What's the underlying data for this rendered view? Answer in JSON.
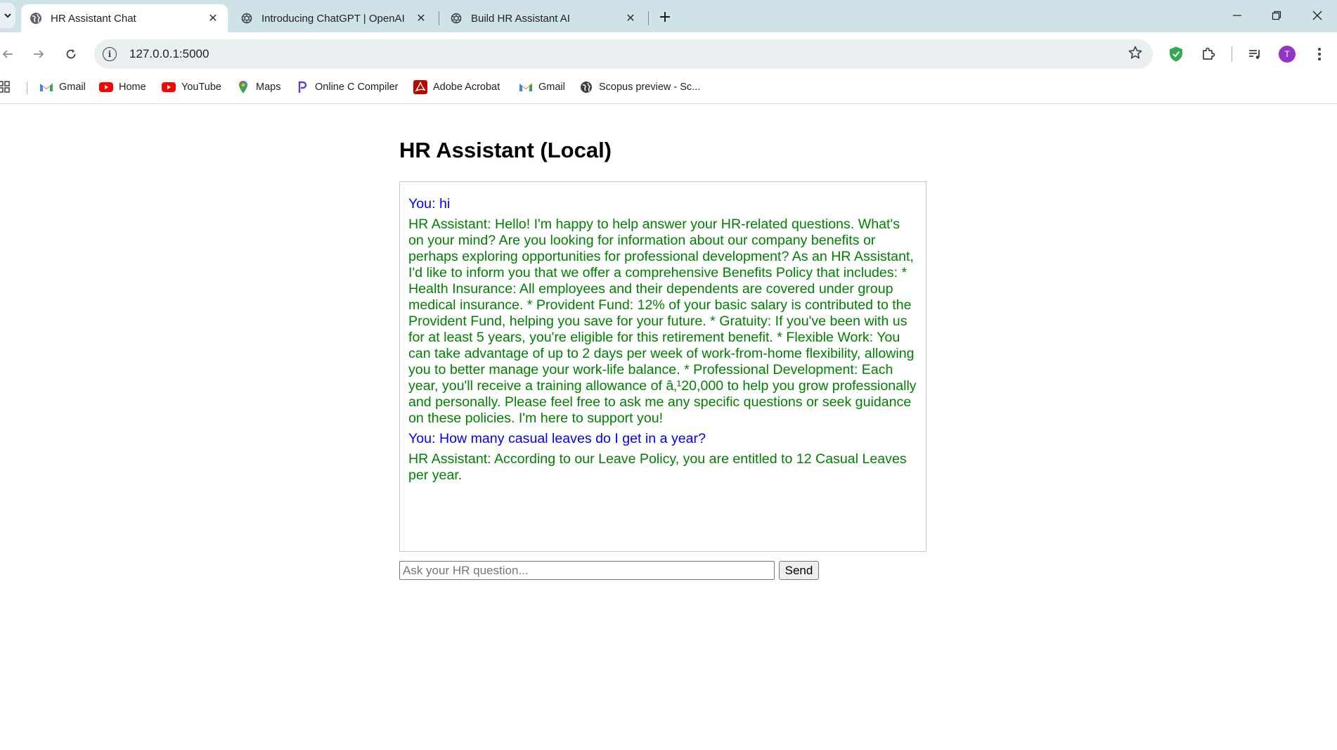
{
  "tabs": [
    {
      "title": "HR Assistant Chat",
      "active": true,
      "icon": "globe-icon"
    },
    {
      "title": "Introducing ChatGPT | OpenAI",
      "active": false,
      "icon": "openai-icon"
    },
    {
      "title": "Build HR Assistant AI",
      "active": false,
      "icon": "openai-icon"
    }
  ],
  "address_bar": {
    "url": "127.0.0.1:5000"
  },
  "bookmarks": [
    {
      "label": "Gmail",
      "icon": "gmail-icon"
    },
    {
      "label": "Home",
      "icon": "youtube-icon"
    },
    {
      "label": "YouTube",
      "icon": "youtube-icon"
    },
    {
      "label": "Maps",
      "icon": "maps-icon"
    },
    {
      "label": "Online C Compiler",
      "icon": "programiz-icon"
    },
    {
      "label": "Adobe Acrobat",
      "icon": "acrobat-icon"
    },
    {
      "label": "Gmail",
      "icon": "gmail-icon"
    },
    {
      "label": "Scopus preview - Sc...",
      "icon": "globe-icon"
    }
  ],
  "profile": {
    "initial": "T",
    "color": "#9334c4"
  },
  "page": {
    "title": "HR Assistant (Local)",
    "messages": [
      {
        "role": "user",
        "text": "You: hi"
      },
      {
        "role": "bot",
        "text": "HR Assistant: Hello! I'm happy to help answer your HR-related questions. What's on your mind? Are you looking for information about our company benefits or perhaps exploring opportunities for professional development? As an HR Assistant, I'd like to inform you that we offer a comprehensive Benefits Policy that includes: * Health Insurance: All employees and their dependents are covered under group medical insurance. * Provident Fund: 12% of your basic salary is contributed to the Provident Fund, helping you save for your future. * Gratuity: If you've been with us for at least 5 years, you're eligible for this retirement benefit. * Flexible Work: You can take advantage of up to 2 days per week of work-from-home flexibility, allowing you to better manage your work-life balance. * Professional Development: Each year, you'll receive a training allowance of â‚¹20,000 to help you grow professionally and personally. Please feel free to ask me any specific questions or seek guidance on these policies. I'm here to support you!"
      },
      {
        "role": "user",
        "text": "You: How many casual leaves do I get in a year?"
      },
      {
        "role": "bot",
        "text": "HR Assistant: According to our Leave Policy, you are entitled to 12 Casual Leaves per year."
      }
    ],
    "input_placeholder": "Ask your HR question...",
    "send_label": "Send"
  },
  "colors": {
    "user_text": "#0000ff",
    "bot_text": "#008000",
    "tabstrip": "#cfe2e8"
  }
}
